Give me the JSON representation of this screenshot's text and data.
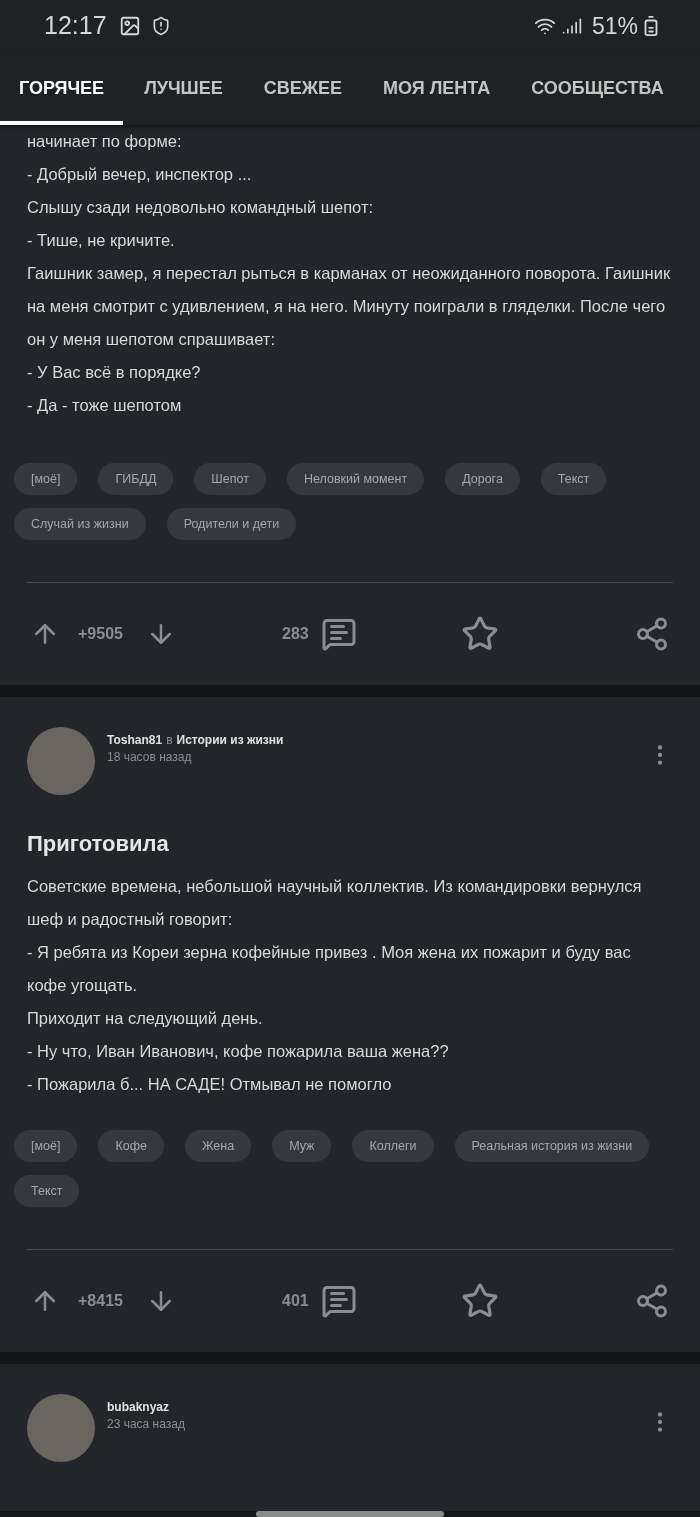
{
  "status_bar": {
    "time": "12:17",
    "battery": "51%"
  },
  "tabs": [
    {
      "label": "ГОРЯЧЕЕ",
      "selected": true
    },
    {
      "label": "ЛУЧШЕЕ",
      "selected": false
    },
    {
      "label": "СВЕЖЕЕ",
      "selected": false
    },
    {
      "label": "МОЯ ЛЕНТА",
      "selected": false
    },
    {
      "label": "СООБЩЕСТВА",
      "selected": false
    }
  ],
  "posts": [
    {
      "body": [
        "начинает по форме:",
        "- Добрый вечер, инспектор ...",
        "Слышу сзади недовольно командный шепот:",
        "- Тише, не кричите.",
        "Гаишник замер, я перестал рыться в карманах от неожиданного поворота. Гаишник на меня смотрит с удивлением, я на него. Минуту поиграли в гляделки. После чего он у меня шепотом спрашивает:",
        "- У Вас всё в порядке?",
        "- Да - тоже шепотом"
      ],
      "tags": [
        "[моё]",
        "ГИБДД",
        "Шепот",
        "Неловкий момент",
        "Дорога",
        "Текст",
        "Случай из жизни",
        "Родители и дети"
      ],
      "rating": "+9505",
      "comments": "283"
    },
    {
      "author": "Toshan81",
      "preposition": "в",
      "community": "Истории из жизни",
      "time": "18 часов назад",
      "title": "Приготовила",
      "body": [
        "Советские времена, небольшой научный коллектив. Из командировки вернулся шеф и радостный говорит:",
        "- Я ребята из Кореи зерна кофейные привез . Моя жена их пожарит и буду вас кофе угощать.",
        "Приходит на следующий день.",
        "- Ну что, Иван Иванович,  кофе пожарила ваша жена??",
        "- Пожарила б... НА САДЕ! Отмывал не помогло"
      ],
      "tags": [
        "[моё]",
        "Кофе",
        "Жена",
        "Муж",
        "Коллеги",
        "Реальная история из жизни",
        "Текст"
      ],
      "rating": "+8415",
      "comments": "401"
    },
    {
      "author": "bubaknyaz",
      "time": "23 часа назад"
    }
  ]
}
